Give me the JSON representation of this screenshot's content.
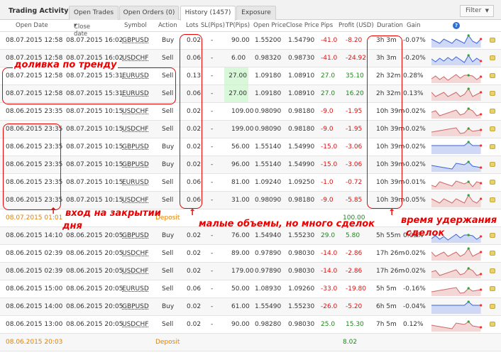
{
  "app": {
    "title": "Trading Activity",
    "tabs": [
      "Open Trades",
      "Open Orders (0)",
      "History (1457)",
      "Exposure"
    ],
    "filter_label": "Filter"
  },
  "columns": [
    "Open Date",
    "Close date",
    "Symbol",
    "Action",
    "Lots",
    "SL(Pips)",
    "TP(Pips)",
    "Open Price",
    "Close Price",
    "Pips",
    "Profit (USD)",
    "Duration",
    "Gain"
  ],
  "rows": [
    {
      "open": "08.07.2015 12:58",
      "close": "08.07.2015 16:02",
      "sym": "GBPUSD",
      "act": "Buy",
      "lots": "0.02",
      "sl": "-",
      "tp": "90.00",
      "op": "1.55200",
      "cp": "1.54790",
      "pips": "-41.0",
      "profit": "-8.20",
      "dur": "3h 3m",
      "gain": "-0.07%",
      "spark": "blue",
      "neg": true
    },
    {
      "open": "08.07.2015 12:58",
      "close": "08.07.2015 16:02",
      "sym": "USDCHF",
      "act": "Sell",
      "lots": "0.06",
      "sl": "-",
      "tp": "6.00",
      "op": "0.98320",
      "cp": "0.98730",
      "pips": "-41.0",
      "profit": "-24.92",
      "dur": "3h 3m",
      "gain": "-0.20%",
      "spark": "blue",
      "neg": true
    },
    {
      "open": "08.07.2015 12:58",
      "close": "08.07.2015 15:31",
      "sym": "EURUSD",
      "act": "Sell",
      "lots": "0.13",
      "sl": "-",
      "tp": "27.00",
      "op": "1.09180",
      "cp": "1.08910",
      "pips": "27.0",
      "profit": "35.10",
      "dur": "2h 32m",
      "gain": "0.28%",
      "spark": "red",
      "neg": false,
      "tphl": true
    },
    {
      "open": "08.07.2015 12:58",
      "close": "08.07.2015 15:31",
      "sym": "EURUSD",
      "act": "Sell",
      "lots": "0.06",
      "sl": "-",
      "tp": "27.00",
      "op": "1.09180",
      "cp": "1.08910",
      "pips": "27.0",
      "profit": "16.20",
      "dur": "2h 32m",
      "gain": "0.13%",
      "spark": "red",
      "neg": false,
      "tphl": true
    },
    {
      "open": "08.06.2015 23:35",
      "close": "08.07.2015 10:15",
      "sym": "USDCHF",
      "act": "Sell",
      "lots": "0.02",
      "sl": "-",
      "tp": "109.00",
      "op": "0.98090",
      "cp": "0.98180",
      "pips": "-9.0",
      "profit": "-1.95",
      "dur": "10h 39m",
      "gain": "-0.02%",
      "spark": "red",
      "neg": true
    },
    {
      "open": "08.06.2015 23:35",
      "close": "08.07.2015 10:15",
      "sym": "USDCHF",
      "act": "Sell",
      "lots": "0.02",
      "sl": "-",
      "tp": "199.00",
      "op": "0.98090",
      "cp": "0.98180",
      "pips": "-9.0",
      "profit": "-1.95",
      "dur": "10h 39m",
      "gain": "-0.02%",
      "spark": "red",
      "neg": true
    },
    {
      "open": "08.06.2015 23:35",
      "close": "08.07.2015 10:15",
      "sym": "GBPUSD",
      "act": "Buy",
      "lots": "0.02",
      "sl": "-",
      "tp": "56.00",
      "op": "1.55140",
      "cp": "1.54990",
      "pips": "-15.0",
      "profit": "-3.06",
      "dur": "10h 39m",
      "gain": "-0.02%",
      "spark": "blue",
      "neg": true
    },
    {
      "open": "08.06.2015 23:35",
      "close": "08.07.2015 10:15",
      "sym": "GBPUSD",
      "act": "Buy",
      "lots": "0.02",
      "sl": "-",
      "tp": "96.00",
      "op": "1.55140",
      "cp": "1.54990",
      "pips": "-15.0",
      "profit": "-3.06",
      "dur": "10h 39m",
      "gain": "-0.02%",
      "spark": "blue",
      "neg": true
    },
    {
      "open": "08.06.2015 23:35",
      "close": "08.07.2015 10:15",
      "sym": "EURUSD",
      "act": "Sell",
      "lots": "0.06",
      "sl": "-",
      "tp": "81.00",
      "op": "1.09240",
      "cp": "1.09250",
      "pips": "-1.0",
      "profit": "-0.72",
      "dur": "10h 39m",
      "gain": "-0.01%",
      "spark": "red",
      "neg": true
    },
    {
      "open": "08.06.2015 23:35",
      "close": "08.07.2015 10:15",
      "sym": "USDCHF",
      "act": "Sell",
      "lots": "0.06",
      "sl": "-",
      "tp": "31.00",
      "op": "0.98090",
      "cp": "0.98180",
      "pips": "-9.0",
      "profit": "-5.85",
      "dur": "10h 39m",
      "gain": "-0.05%",
      "spark": "red",
      "neg": true
    },
    {
      "type": "deposit",
      "open": "08.07.2015 01:01",
      "act": "Deposit",
      "profit": "100.00"
    },
    {
      "open": "08.06.2015 14:10",
      "close": "08.06.2015 20:05",
      "sym": "GBPUSD",
      "act": "Buy",
      "lots": "0.02",
      "sl": "-",
      "tp": "76.00",
      "op": "1.54940",
      "cp": "1.55230",
      "pips": "29.0",
      "profit": "5.80",
      "dur": "5h 55m",
      "gain": "0.05%",
      "spark": "blue",
      "neg": false
    },
    {
      "open": "08.06.2015 02:39",
      "close": "08.06.2015 20:05",
      "sym": "USDCHF",
      "act": "Sell",
      "lots": "0.02",
      "sl": "-",
      "tp": "89.00",
      "op": "0.97890",
      "cp": "0.98030",
      "pips": "-14.0",
      "profit": "-2.86",
      "dur": "17h 26m",
      "gain": "-0.02%",
      "spark": "red",
      "neg": true
    },
    {
      "open": "08.06.2015 02:39",
      "close": "08.06.2015 20:05",
      "sym": "USDCHF",
      "act": "Sell",
      "lots": "0.02",
      "sl": "-",
      "tp": "179.00",
      "op": "0.97890",
      "cp": "0.98030",
      "pips": "-14.0",
      "profit": "-2.86",
      "dur": "17h 26m",
      "gain": "-0.02%",
      "spark": "red",
      "neg": true
    },
    {
      "open": "08.06.2015 15:00",
      "close": "08.06.2015 20:05",
      "sym": "EURUSD",
      "act": "Sell",
      "lots": "0.06",
      "sl": "-",
      "tp": "50.00",
      "op": "1.08930",
      "cp": "1.09260",
      "pips": "-33.0",
      "profit": "-19.80",
      "dur": "5h 5m",
      "gain": "-0.16%",
      "spark": "red",
      "neg": true
    },
    {
      "open": "08.06.2015 14:00",
      "close": "08.06.2015 20:05",
      "sym": "GBPUSD",
      "act": "Buy",
      "lots": "0.02",
      "sl": "-",
      "tp": "61.00",
      "op": "1.55490",
      "cp": "1.55230",
      "pips": "-26.0",
      "profit": "-5.20",
      "dur": "6h 5m",
      "gain": "-0.04%",
      "spark": "blue",
      "neg": true
    },
    {
      "open": "08.06.2015 13:00",
      "close": "08.06.2015 20:05",
      "sym": "USDCHF",
      "act": "Sell",
      "lots": "0.02",
      "sl": "-",
      "tp": "90.00",
      "op": "0.98280",
      "cp": "0.98030",
      "pips": "25.0",
      "profit": "15.30",
      "dur": "7h 5m",
      "gain": "0.12%",
      "spark": "red",
      "neg": false
    },
    {
      "type": "deposit",
      "open": "08.06.2015 20:03",
      "act": "Deposit",
      "profit": "8.02"
    }
  ],
  "annotations": {
    "trend": "доливка по тренду",
    "entry_line1": "вход на закрытии",
    "entry_line2": "дня",
    "volumes": "малые объемы, но много сделок",
    "hold_line1": "время удержания",
    "hold_line2": "сделок"
  },
  "colors": {
    "negative": "#d11111",
    "positive": "#1a8a1a",
    "deposit": "#e08000",
    "annotation": "#ee0000"
  }
}
